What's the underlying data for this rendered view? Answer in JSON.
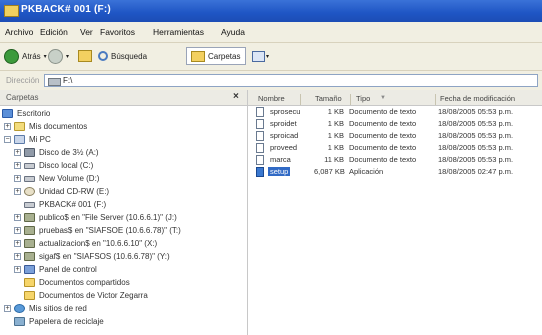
{
  "window": {
    "title": "PKBACK# 001 (F:)"
  },
  "menu": [
    "Archivo",
    "Edición",
    "Ver",
    "Favoritos",
    "Herramientas",
    "Ayuda"
  ],
  "toolbar": {
    "back": "Atrás",
    "search": "Búsqueda",
    "folders": "Carpetas"
  },
  "address": {
    "label": "Dirección",
    "value": "F:\\"
  },
  "folders_pane": {
    "title": "Carpetas",
    "close": "×"
  },
  "tree": [
    {
      "label": "Escritorio",
      "expander": ""
    },
    {
      "label": "Mis documentos",
      "expander": "+"
    },
    {
      "label": "Mi PC",
      "expander": "−"
    },
    {
      "label": "Disco de 3½ (A:)",
      "expander": "+"
    },
    {
      "label": "Disco local (C:)",
      "expander": "+"
    },
    {
      "label": "New Volume (D:)",
      "expander": "+"
    },
    {
      "label": "Unidad CD-RW (E:)",
      "expander": "+"
    },
    {
      "label": "PKBACK# 001 (F:)",
      "expander": ""
    },
    {
      "label": "publico$ en \"File Server (10.6.6.1)\" (J:)",
      "expander": "+"
    },
    {
      "label": "pruebas$ en \"SIAFSOE (10.6.6.78)\" (T:)",
      "expander": "+"
    },
    {
      "label": "actualizacion$ en \"10.6.6.10\" (X:)",
      "expander": "+"
    },
    {
      "label": "sigaf$ en \"SIAFSOS (10.6.6.78)\" (Y:)",
      "expander": "+"
    },
    {
      "label": "Panel de control",
      "expander": "+"
    },
    {
      "label": "Documentos compartidos",
      "expander": ""
    },
    {
      "label": "Documentos de Victor Zegarra",
      "expander": ""
    },
    {
      "label": "Mis sitios de red",
      "expander": "+"
    },
    {
      "label": "Papelera de reciclaje",
      "expander": ""
    }
  ],
  "columns": {
    "name": "Nombre",
    "size": "Tamaño",
    "type": "Tipo",
    "date": "Fecha de modificación",
    "sort_arrow": "▼"
  },
  "files": [
    {
      "name": "sprosecu",
      "size": "1 KB",
      "type": "Documento de texto",
      "date": "18/08/2005 05:53 p.m."
    },
    {
      "name": "sproidet",
      "size": "1 KB",
      "type": "Documento de texto",
      "date": "18/08/2005 05:53 p.m."
    },
    {
      "name": "sproicad",
      "size": "1 KB",
      "type": "Documento de texto",
      "date": "18/08/2005 05:53 p.m."
    },
    {
      "name": "proveed",
      "size": "1 KB",
      "type": "Documento de texto",
      "date": "18/08/2005 05:53 p.m."
    },
    {
      "name": "marca",
      "size": "11 KB",
      "type": "Documento de texto",
      "date": "18/08/2005 05:53 p.m."
    },
    {
      "name": "setup",
      "size": "6,087 KB",
      "type": "Aplicación",
      "date": "18/08/2005 02:47 p.m."
    }
  ]
}
